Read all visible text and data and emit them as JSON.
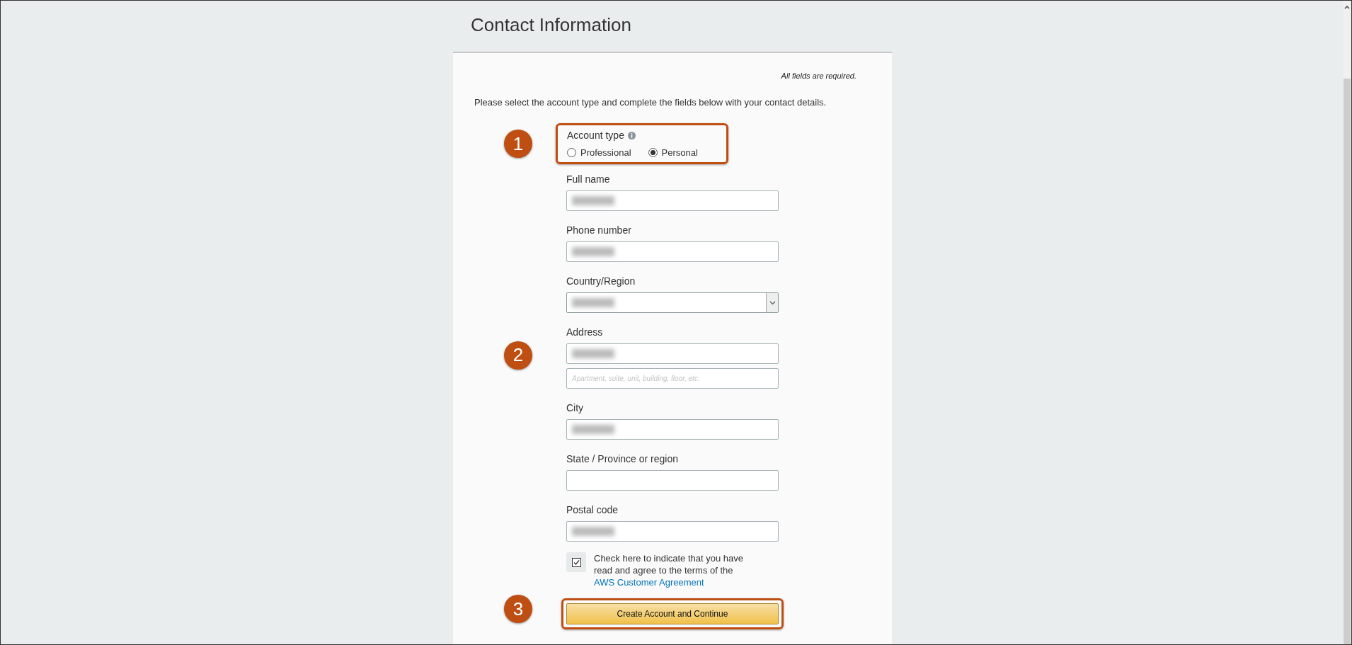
{
  "page": {
    "title": "Contact Information"
  },
  "required_note": "All fields are required.",
  "intro": "Please select the account type and complete the fields below with your contact details.",
  "account_type": {
    "label": "Account type",
    "callout": "1",
    "highlighted": true,
    "options": [
      {
        "label": "Professional",
        "selected": false
      },
      {
        "label": "Personal",
        "selected": true
      }
    ]
  },
  "fields": [
    {
      "label": "Full name",
      "kind": "text",
      "inputs": [
        {
          "redacted": true
        }
      ]
    },
    {
      "label": "Phone number",
      "kind": "text",
      "inputs": [
        {
          "redacted": true
        }
      ]
    },
    {
      "label": "Country/Region",
      "kind": "select",
      "inputs": [
        {
          "redacted": true
        }
      ]
    },
    {
      "label": "Address",
      "kind": "text",
      "callout": "2",
      "inputs": [
        {
          "redacted": true
        },
        {
          "redacted": false,
          "placeholder": "Apartment, suite, unit, building, floor, etc."
        }
      ]
    },
    {
      "label": "City",
      "kind": "text",
      "inputs": [
        {
          "redacted": true
        }
      ]
    },
    {
      "label": "State / Province or region",
      "kind": "text",
      "inputs": [
        {
          "redacted": false
        }
      ]
    },
    {
      "label": "Postal code",
      "kind": "text",
      "inputs": [
        {
          "redacted": true
        }
      ]
    }
  ],
  "agreement": {
    "text": "Check here to indicate that you have read and agree to the terms of the ",
    "link": "AWS Customer Agreement",
    "checked": true
  },
  "submit": {
    "label": "Create Account and Continue",
    "callout": "3",
    "highlighted": true
  }
}
